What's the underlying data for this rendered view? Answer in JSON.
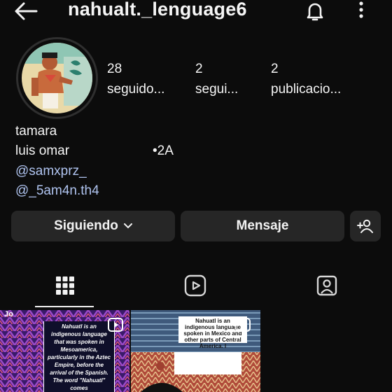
{
  "header": {
    "username": "nahualt._lenguage6",
    "back_icon": "back-arrow-icon",
    "bell_icon": "bell-icon",
    "more_icon": "more-vertical-icon"
  },
  "stats": [
    {
      "value": "28",
      "label": "seguido..."
    },
    {
      "value": "2",
      "label": "segui..."
    },
    {
      "value": "2",
      "label": "publicacio..."
    }
  ],
  "bio": {
    "name": "tamara",
    "line2": "luis omar",
    "line2_extra": "•2A",
    "mention1": "@samxprz_",
    "mention2": "@_5am4n.th4"
  },
  "buttons": {
    "following": "Siguiendo",
    "message": "Mensaje",
    "add_user_icon": "add-person-icon"
  },
  "tabs": [
    {
      "icon": "grid-icon",
      "active": true
    },
    {
      "icon": "reels-icon",
      "active": false
    },
    {
      "icon": "tagged-icon",
      "active": false
    }
  ],
  "posts": [
    {
      "caption": "Nahuatl is an indigenous language that was spoken in Mesoamerica, particularly in the Aztec Empire, before the arrival of the Spanish. The word \"Nahuatl\" comes",
      "top_label": "Jo"
    },
    {
      "caption": "Nahuatl is an indigenous language spoken in Mexico and other parts of Central America. I"
    }
  ],
  "colors": {
    "background": "#0c0c0c",
    "button": "#262626",
    "mention": "#b0c4f0"
  }
}
